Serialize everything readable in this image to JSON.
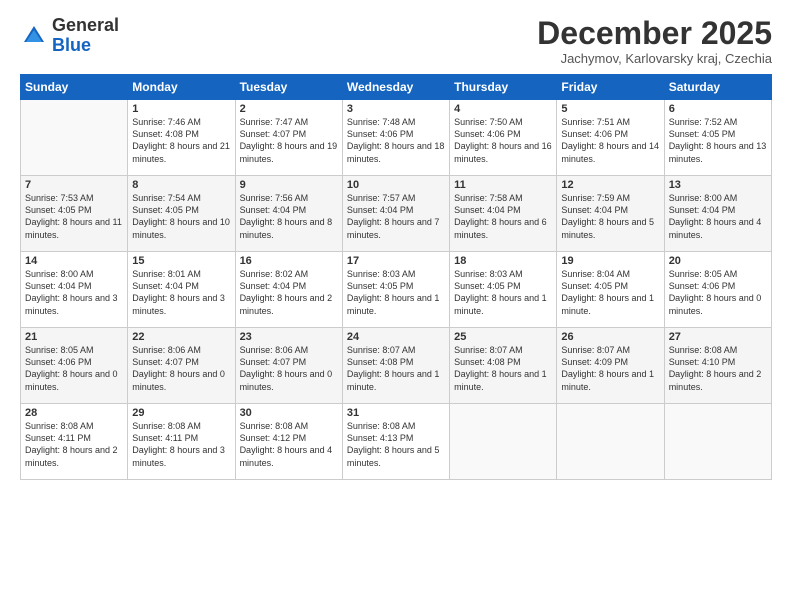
{
  "header": {
    "logo_general": "General",
    "logo_blue": "Blue",
    "title": "December 2025",
    "location": "Jachymov, Karlovarsky kraj, Czechia"
  },
  "weekdays": [
    "Sunday",
    "Monday",
    "Tuesday",
    "Wednesday",
    "Thursday",
    "Friday",
    "Saturday"
  ],
  "weeks": [
    [
      {
        "day": "",
        "sunrise": "",
        "sunset": "",
        "daylight": ""
      },
      {
        "day": "1",
        "sunrise": "Sunrise: 7:46 AM",
        "sunset": "Sunset: 4:08 PM",
        "daylight": "Daylight: 8 hours and 21 minutes."
      },
      {
        "day": "2",
        "sunrise": "Sunrise: 7:47 AM",
        "sunset": "Sunset: 4:07 PM",
        "daylight": "Daylight: 8 hours and 19 minutes."
      },
      {
        "day": "3",
        "sunrise": "Sunrise: 7:48 AM",
        "sunset": "Sunset: 4:06 PM",
        "daylight": "Daylight: 8 hours and 18 minutes."
      },
      {
        "day": "4",
        "sunrise": "Sunrise: 7:50 AM",
        "sunset": "Sunset: 4:06 PM",
        "daylight": "Daylight: 8 hours and 16 minutes."
      },
      {
        "day": "5",
        "sunrise": "Sunrise: 7:51 AM",
        "sunset": "Sunset: 4:06 PM",
        "daylight": "Daylight: 8 hours and 14 minutes."
      },
      {
        "day": "6",
        "sunrise": "Sunrise: 7:52 AM",
        "sunset": "Sunset: 4:05 PM",
        "daylight": "Daylight: 8 hours and 13 minutes."
      }
    ],
    [
      {
        "day": "7",
        "sunrise": "Sunrise: 7:53 AM",
        "sunset": "Sunset: 4:05 PM",
        "daylight": "Daylight: 8 hours and 11 minutes."
      },
      {
        "day": "8",
        "sunrise": "Sunrise: 7:54 AM",
        "sunset": "Sunset: 4:05 PM",
        "daylight": "Daylight: 8 hours and 10 minutes."
      },
      {
        "day": "9",
        "sunrise": "Sunrise: 7:56 AM",
        "sunset": "Sunset: 4:04 PM",
        "daylight": "Daylight: 8 hours and 8 minutes."
      },
      {
        "day": "10",
        "sunrise": "Sunrise: 7:57 AM",
        "sunset": "Sunset: 4:04 PM",
        "daylight": "Daylight: 8 hours and 7 minutes."
      },
      {
        "day": "11",
        "sunrise": "Sunrise: 7:58 AM",
        "sunset": "Sunset: 4:04 PM",
        "daylight": "Daylight: 8 hours and 6 minutes."
      },
      {
        "day": "12",
        "sunrise": "Sunrise: 7:59 AM",
        "sunset": "Sunset: 4:04 PM",
        "daylight": "Daylight: 8 hours and 5 minutes."
      },
      {
        "day": "13",
        "sunrise": "Sunrise: 8:00 AM",
        "sunset": "Sunset: 4:04 PM",
        "daylight": "Daylight: 8 hours and 4 minutes."
      }
    ],
    [
      {
        "day": "14",
        "sunrise": "Sunrise: 8:00 AM",
        "sunset": "Sunset: 4:04 PM",
        "daylight": "Daylight: 8 hours and 3 minutes."
      },
      {
        "day": "15",
        "sunrise": "Sunrise: 8:01 AM",
        "sunset": "Sunset: 4:04 PM",
        "daylight": "Daylight: 8 hours and 3 minutes."
      },
      {
        "day": "16",
        "sunrise": "Sunrise: 8:02 AM",
        "sunset": "Sunset: 4:04 PM",
        "daylight": "Daylight: 8 hours and 2 minutes."
      },
      {
        "day": "17",
        "sunrise": "Sunrise: 8:03 AM",
        "sunset": "Sunset: 4:05 PM",
        "daylight": "Daylight: 8 hours and 1 minute."
      },
      {
        "day": "18",
        "sunrise": "Sunrise: 8:03 AM",
        "sunset": "Sunset: 4:05 PM",
        "daylight": "Daylight: 8 hours and 1 minute."
      },
      {
        "day": "19",
        "sunrise": "Sunrise: 8:04 AM",
        "sunset": "Sunset: 4:05 PM",
        "daylight": "Daylight: 8 hours and 1 minute."
      },
      {
        "day": "20",
        "sunrise": "Sunrise: 8:05 AM",
        "sunset": "Sunset: 4:06 PM",
        "daylight": "Daylight: 8 hours and 0 minutes."
      }
    ],
    [
      {
        "day": "21",
        "sunrise": "Sunrise: 8:05 AM",
        "sunset": "Sunset: 4:06 PM",
        "daylight": "Daylight: 8 hours and 0 minutes."
      },
      {
        "day": "22",
        "sunrise": "Sunrise: 8:06 AM",
        "sunset": "Sunset: 4:07 PM",
        "daylight": "Daylight: 8 hours and 0 minutes."
      },
      {
        "day": "23",
        "sunrise": "Sunrise: 8:06 AM",
        "sunset": "Sunset: 4:07 PM",
        "daylight": "Daylight: 8 hours and 0 minutes."
      },
      {
        "day": "24",
        "sunrise": "Sunrise: 8:07 AM",
        "sunset": "Sunset: 4:08 PM",
        "daylight": "Daylight: 8 hours and 1 minute."
      },
      {
        "day": "25",
        "sunrise": "Sunrise: 8:07 AM",
        "sunset": "Sunset: 4:08 PM",
        "daylight": "Daylight: 8 hours and 1 minute."
      },
      {
        "day": "26",
        "sunrise": "Sunrise: 8:07 AM",
        "sunset": "Sunset: 4:09 PM",
        "daylight": "Daylight: 8 hours and 1 minute."
      },
      {
        "day": "27",
        "sunrise": "Sunrise: 8:08 AM",
        "sunset": "Sunset: 4:10 PM",
        "daylight": "Daylight: 8 hours and 2 minutes."
      }
    ],
    [
      {
        "day": "28",
        "sunrise": "Sunrise: 8:08 AM",
        "sunset": "Sunset: 4:11 PM",
        "daylight": "Daylight: 8 hours and 2 minutes."
      },
      {
        "day": "29",
        "sunrise": "Sunrise: 8:08 AM",
        "sunset": "Sunset: 4:11 PM",
        "daylight": "Daylight: 8 hours and 3 minutes."
      },
      {
        "day": "30",
        "sunrise": "Sunrise: 8:08 AM",
        "sunset": "Sunset: 4:12 PM",
        "daylight": "Daylight: 8 hours and 4 minutes."
      },
      {
        "day": "31",
        "sunrise": "Sunrise: 8:08 AM",
        "sunset": "Sunset: 4:13 PM",
        "daylight": "Daylight: 8 hours and 5 minutes."
      },
      {
        "day": "",
        "sunrise": "",
        "sunset": "",
        "daylight": ""
      },
      {
        "day": "",
        "sunrise": "",
        "sunset": "",
        "daylight": ""
      },
      {
        "day": "",
        "sunrise": "",
        "sunset": "",
        "daylight": ""
      }
    ]
  ]
}
